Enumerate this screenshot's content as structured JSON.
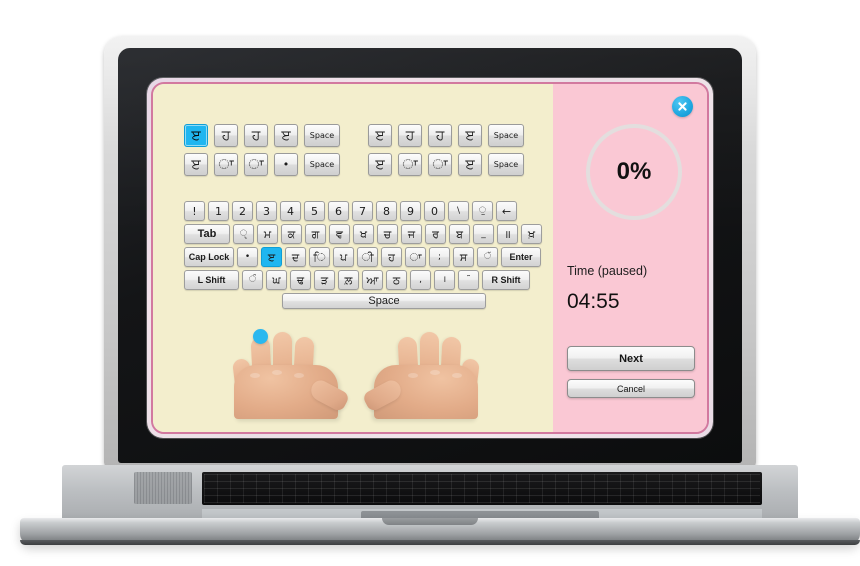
{
  "app": {
    "close_icon": "close-icon",
    "accent_blue": "#1fb6f0",
    "panel_pink": "#fac8d4",
    "panel_cream": "#f3eecd",
    "border_pink": "#d2799f"
  },
  "exercise": {
    "groups": [
      {
        "rows": [
          [
            {
              "char": "ੲ",
              "kind": "char",
              "active": true
            },
            {
              "char": "ਹ",
              "kind": "char",
              "active": false
            },
            {
              "char": "ਹ",
              "kind": "char",
              "active": false
            },
            {
              "char": "ੲ",
              "kind": "char",
              "active": false
            },
            {
              "char": "Space",
              "kind": "wide",
              "active": false
            }
          ],
          [
            {
              "char": "ੲ",
              "kind": "char",
              "active": false
            },
            {
              "char": "ਾ",
              "kind": "char",
              "active": false
            },
            {
              "char": "ਾ",
              "kind": "char",
              "active": false
            },
            {
              "char": "•",
              "kind": "dot",
              "active": false
            },
            {
              "char": "Space",
              "kind": "wide",
              "active": false
            }
          ]
        ]
      },
      {
        "rows": [
          [
            {
              "char": "ੲ",
              "kind": "char",
              "active": false
            },
            {
              "char": "ਹ",
              "kind": "char",
              "active": false
            },
            {
              "char": "ਹ",
              "kind": "char",
              "active": false
            },
            {
              "char": "ੲ",
              "kind": "char",
              "active": false
            },
            {
              "char": "Space",
              "kind": "wide",
              "active": false
            }
          ],
          [
            {
              "char": "ੲ",
              "kind": "char",
              "active": false
            },
            {
              "char": "ਾ",
              "kind": "char",
              "active": false
            },
            {
              "char": "ਾ",
              "kind": "char",
              "active": false
            },
            {
              "char": "ੲ",
              "kind": "char",
              "active": false
            },
            {
              "char": "Space",
              "kind": "wide",
              "active": false
            }
          ]
        ]
      }
    ]
  },
  "keyboard": {
    "rows": [
      {
        "name": "number-row",
        "keys": [
          {
            "label": "!",
            "cls": "",
            "active": false
          },
          {
            "label": "1",
            "cls": "",
            "active": false
          },
          {
            "label": "2",
            "cls": "",
            "active": false
          },
          {
            "label": "3",
            "cls": "",
            "active": false
          },
          {
            "label": "4",
            "cls": "",
            "active": false
          },
          {
            "label": "5",
            "cls": "",
            "active": false
          },
          {
            "label": "6",
            "cls": "",
            "active": false
          },
          {
            "label": "7",
            "cls": "",
            "active": false
          },
          {
            "label": "8",
            "cls": "",
            "active": false
          },
          {
            "label": "9",
            "cls": "",
            "active": false
          },
          {
            "label": "0",
            "cls": "",
            "active": false
          },
          {
            "label": "\\",
            "cls": "sm",
            "active": false
          },
          {
            "label": "ੁ",
            "cls": "sm",
            "active": false
          },
          {
            "label": "←",
            "cls": "",
            "active": false
          }
        ]
      },
      {
        "name": "tab-row",
        "keys": [
          {
            "label": "Tab",
            "cls": "lbl tab",
            "active": false
          },
          {
            "label": "ੵ",
            "cls": "sm",
            "active": false
          },
          {
            "label": "ਮ",
            "cls": "",
            "active": false
          },
          {
            "label": "ਕ",
            "cls": "",
            "active": false
          },
          {
            "label": "ਗ",
            "cls": "",
            "active": false
          },
          {
            "label": "ਵ",
            "cls": "",
            "active": false
          },
          {
            "label": "ਖ",
            "cls": "",
            "active": false
          },
          {
            "label": "ਚ",
            "cls": "",
            "active": false
          },
          {
            "label": "ਜ",
            "cls": "",
            "active": false
          },
          {
            "label": "ਰ",
            "cls": "",
            "active": false
          },
          {
            "label": "ਬ",
            "cls": "",
            "active": false
          },
          {
            "label": "_",
            "cls": "sm",
            "active": false
          },
          {
            "label": "॥",
            "cls": "",
            "active": false
          },
          {
            "label": "ਖ਼",
            "cls": "",
            "active": false
          }
        ]
      },
      {
        "name": "caps-row",
        "keys": [
          {
            "label": "Cap Lock",
            "cls": "lbl caps",
            "active": false
          },
          {
            "label": "•",
            "cls": "sm",
            "active": false
          },
          {
            "label": "ੲ",
            "cls": "",
            "active": true
          },
          {
            "label": "ਦ",
            "cls": "",
            "active": false
          },
          {
            "label": "ਿ",
            "cls": "",
            "active": false
          },
          {
            "label": "ਪ",
            "cls": "",
            "active": false
          },
          {
            "label": "ੀ",
            "cls": "",
            "active": false
          },
          {
            "label": "ਹ",
            "cls": "",
            "active": false
          },
          {
            "label": "ਾ",
            "cls": "",
            "active": false
          },
          {
            "label": ";",
            "cls": "sm",
            "active": false
          },
          {
            "label": "ਸ",
            "cls": "",
            "active": false
          },
          {
            "label": "ੱ",
            "cls": "sm",
            "active": false
          },
          {
            "label": "Enter",
            "cls": "lbl enter",
            "active": false
          }
        ]
      },
      {
        "name": "shift-row",
        "keys": [
          {
            "label": "L Shift",
            "cls": "lbl shiftl",
            "active": false
          },
          {
            "label": "ੰ",
            "cls": "sm",
            "active": false
          },
          {
            "label": "ਘ",
            "cls": "",
            "active": false
          },
          {
            "label": "ਢ",
            "cls": "",
            "active": false
          },
          {
            "label": "ੜ",
            "cls": "",
            "active": false
          },
          {
            "label": "ਲ਼",
            "cls": "",
            "active": false
          },
          {
            "label": "ਆ",
            "cls": "",
            "active": false
          },
          {
            "label": "ਠ",
            "cls": "",
            "active": false
          },
          {
            "label": ",",
            "cls": "sm",
            "active": false
          },
          {
            "label": "।",
            "cls": "sm",
            "active": false
          },
          {
            "label": "˜",
            "cls": "sm",
            "active": false
          },
          {
            "label": "R Shift",
            "cls": "lbl shiftr",
            "active": false
          }
        ]
      }
    ],
    "spacebar": "Space"
  },
  "hands": {
    "left_label": "left-hand",
    "right_label": "right-hand",
    "marker_finger": "left-pinky"
  },
  "status": {
    "progress_percent": "0%",
    "time_label": "Time (paused)",
    "time_value": "04:55"
  },
  "buttons": {
    "next": "Next",
    "cancel": "Cancel"
  }
}
